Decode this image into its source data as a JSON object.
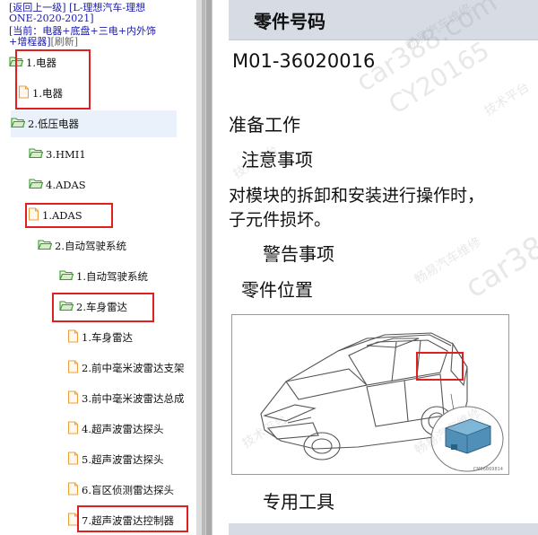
{
  "nav": {
    "back_link": "[返回上一级]",
    "title_line1": "[L-理想汽车-理想",
    "title_line2": "ONE-2020-2021]",
    "current_line1": "[当前：电器+底盘+三电+内外饰",
    "current_line2": "+增程器]",
    "refresh_link": "[刷新]"
  },
  "tree": {
    "items": [
      {
        "label": "1.电器",
        "icon": "folder-open-icon"
      },
      {
        "label": "1.电器",
        "icon": "document-icon"
      },
      {
        "label": "2.低压电器",
        "icon": "folder-open-icon"
      },
      {
        "label": "3.HMI1",
        "icon": "folder-open-icon"
      },
      {
        "label": "4.ADAS",
        "icon": "folder-open-icon"
      },
      {
        "label": "1.ADAS",
        "icon": "document-icon"
      },
      {
        "label": "2.自动驾驶系统",
        "icon": "folder-open-icon"
      },
      {
        "label": "1.自动驾驶系统",
        "icon": "folder-open-icon"
      },
      {
        "label": "2.车身雷达",
        "icon": "folder-open-icon"
      },
      {
        "label": "1.车身雷达",
        "icon": "document-icon"
      },
      {
        "label": "2.前中毫米波雷达支架",
        "icon": "document-icon"
      },
      {
        "label": "3.前中毫米波雷达总成",
        "icon": "document-icon"
      },
      {
        "label": "4.超声波雷达探头",
        "icon": "document-icon"
      },
      {
        "label": "5.超声波雷达探头",
        "icon": "document-icon"
      },
      {
        "label": "6.盲区侦测雷达探头",
        "icon": "document-icon"
      },
      {
        "label": "7.超声波雷达控制器",
        "icon": "document-icon"
      }
    ]
  },
  "doc": {
    "part_number_header": "零件号码",
    "part_number": "M01-36020016",
    "prep_heading": "准备工作",
    "caution_heading": "注意事项",
    "caution_text_line1": "对模块的拆卸和安装进行操作时，",
    "caution_text_line2": "子元件损坏。",
    "warning_heading": "警告事项",
    "location_heading": "零件位置",
    "figure_code": "CM56869814",
    "special_tools_heading": "专用工具"
  },
  "watermarks": [
    "car388.com",
    "CY20165",
    "畅易汽车维修",
    "技术平台"
  ],
  "colors": {
    "link": "#1a1aa8",
    "highlight_box": "#e02020",
    "folder_icon": "#3a9a2a",
    "document_icon": "#e8a040",
    "header_band": "#d6dbe4",
    "selected_row": "#eaf1fb"
  }
}
